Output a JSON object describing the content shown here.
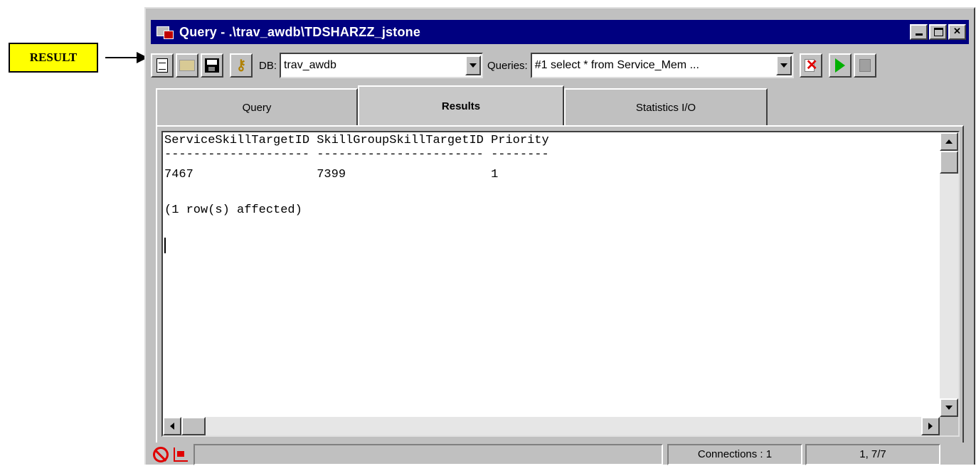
{
  "callout": {
    "label": "RESULT"
  },
  "window": {
    "title": "Query - .\\trav_awdb\\TDSHARZZ_jstone",
    "buttons": [
      "minimize",
      "maximize",
      "close"
    ]
  },
  "toolbar": {
    "icons": [
      "new-query-icon",
      "open-icon",
      "save-icon",
      "options-key-icon"
    ],
    "db_label": "DB:",
    "db_value": "trav_awdb",
    "queries_label": "Queries:",
    "queries_value": "#1 select * from Service_Mem ...",
    "action_icons": [
      "cancel-query-icon",
      "execute-icon",
      "stop-icon"
    ]
  },
  "tabs": [
    {
      "label": "Query",
      "active": false
    },
    {
      "label": "Results",
      "active": true
    },
    {
      "label": "Statistics I/O",
      "active": false
    }
  ],
  "results": {
    "header": "ServiceSkillTargetID SkillGroupSkillTargetID Priority",
    "separator": "-------------------- ----------------------- --------",
    "row": "7467                 7399                    1",
    "footer": "(1 row(s) affected)"
  },
  "statusbar": {
    "connections": "Connections : 1",
    "position": "1, 7/7"
  }
}
